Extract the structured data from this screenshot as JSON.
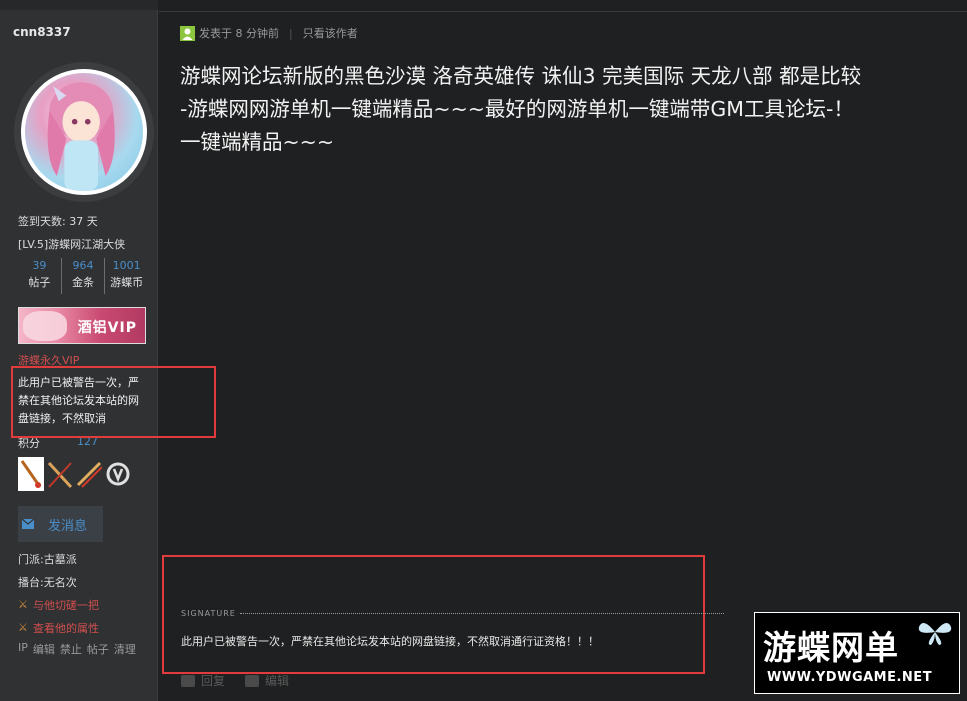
{
  "profile": {
    "username": "cnn8337",
    "checkin_days": "签到天数: 37 天",
    "level": "[LV.5]游蝶网江湖大侠",
    "stats": [
      {
        "num": "39",
        "label": "帖子"
      },
      {
        "num": "964",
        "label": "金条"
      },
      {
        "num": "1001",
        "label": "游蝶币"
      }
    ],
    "vip_badge_text": "酒铝VIP",
    "vip_label": "游蝶永久VIP",
    "warning_text": "此用户已被警告一次，严禁在其他论坛发本站的网盘链接，不然取消",
    "score_label": "积分",
    "score_value": "127",
    "message_button": "发消息",
    "sect": "门派:古墓派",
    "arena": "播台:无名次",
    "link_fight": "与他切磋一把",
    "link_attributes": "查看他的属性",
    "admin_links": [
      "IP",
      "编辑",
      "禁止",
      "帖子",
      "清理"
    ],
    "medal_icons": [
      "sword-medal-icon",
      "double-sword-medal-icon",
      "crossed-swords-medal-icon",
      "overwatch-medal-icon"
    ]
  },
  "post": {
    "posted_time": "发表于 8 分钟前",
    "only_author": "只看该作者",
    "title": "游蝶网论坛新版的黑色沙漠 洛奇英雄传 诛仙3 完美国际 天龙八部 都是比较\n-游蝶网网游单机一键端精品~~~最好的网游单机一键端带GM工具论坛-！\n一键端精品~~~",
    "signature_label": "SIGNATURE",
    "signature_text": "此用户已被警告一次，严禁在其他论坛发本站的网盘链接，不然取消通行证资格！！！",
    "actions": [
      "回复",
      "编辑"
    ]
  },
  "watermark": {
    "cn": "游蝶网单",
    "en": "WWW.YDWGAME.NET"
  },
  "colors": {
    "background": "#1f2021",
    "sidebar": "#2f3133",
    "link_blue": "#4a8ec9",
    "warning_red": "#e23b3b",
    "vip_red": "#d24f4f"
  }
}
